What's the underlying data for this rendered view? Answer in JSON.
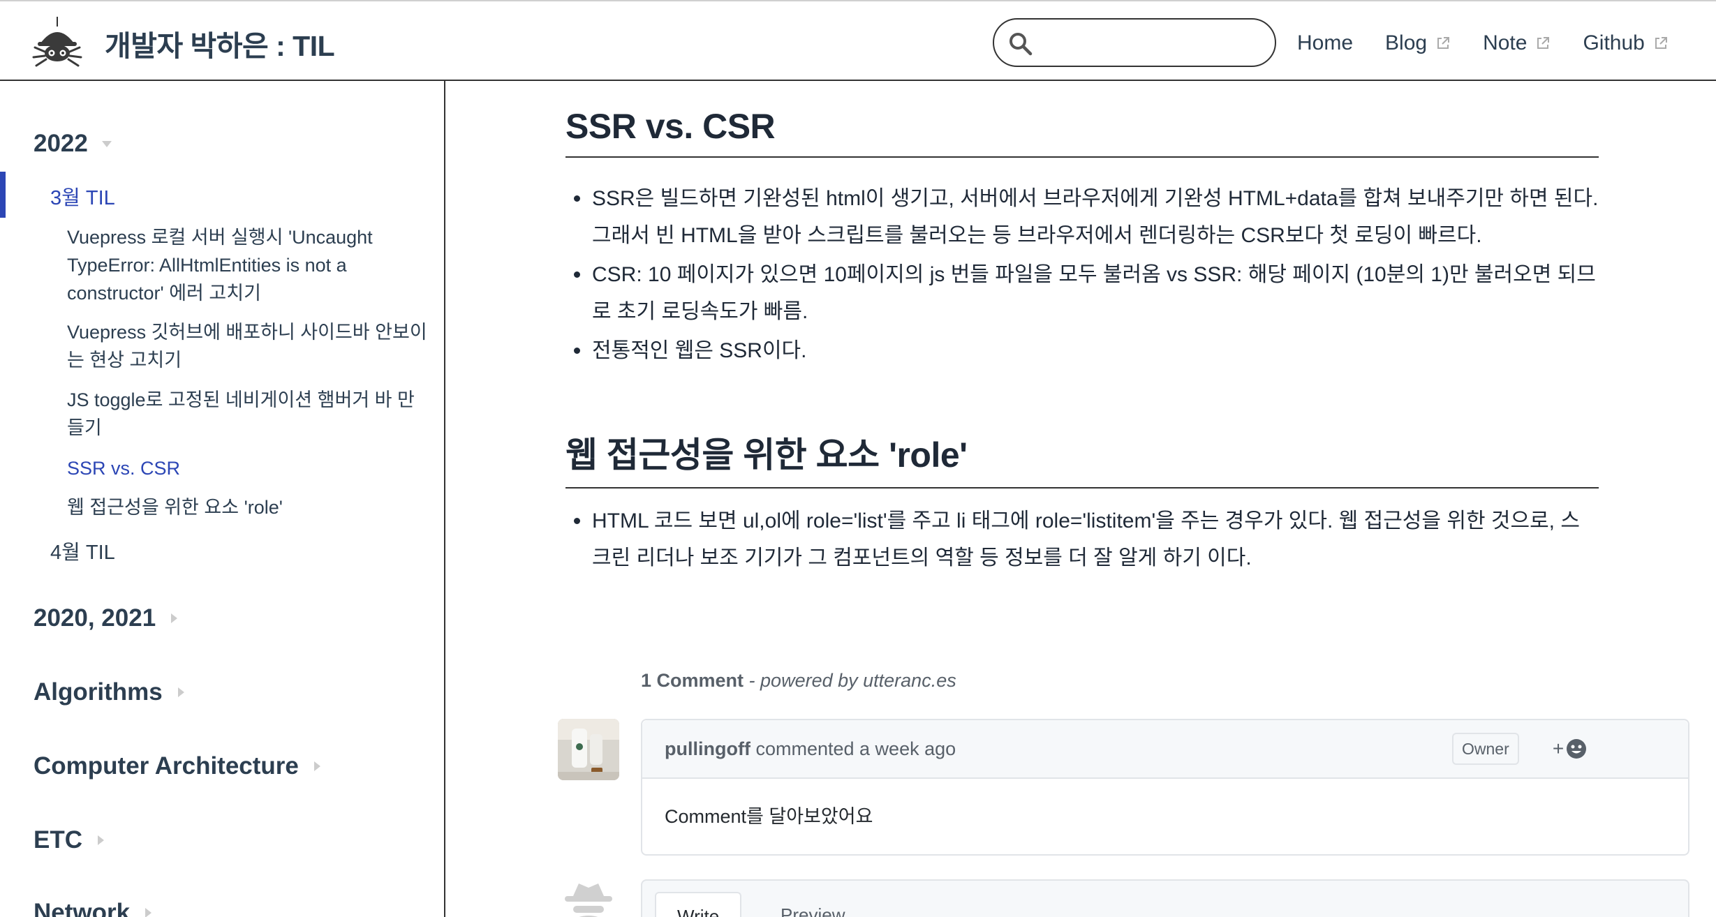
{
  "header": {
    "site_title": "개발자 박하은 : TIL",
    "logo_icon": "spider-logo-icon",
    "search": {
      "placeholder": "",
      "value": ""
    },
    "nav": [
      {
        "label": "Home",
        "external": false
      },
      {
        "label": "Blog",
        "external": true
      },
      {
        "label": "Note",
        "external": true
      },
      {
        "label": "Github",
        "external": true
      }
    ]
  },
  "sidebar": {
    "groups": [
      {
        "label": "2022",
        "expanded": true,
        "subgroups": [
          {
            "label": "3월 TIL",
            "active": true,
            "pages": [
              {
                "label": "Vuepress 로컬 서버 실행시 'Uncaught TypeError: AllHtmlEntities is not a constructor' 에러 고치기"
              },
              {
                "label": "Vuepress 깃허브에 배포하니 사이드바 안보이는 현상 고치기"
              },
              {
                "label": "JS toggle로 고정된 네비게이션 햄버거 바 만들기"
              },
              {
                "label": "SSR vs. CSR",
                "active": true
              },
              {
                "label": "웹 접근성을 위한 요소 'role'"
              }
            ]
          },
          {
            "label": "4월 TIL",
            "active": false
          }
        ]
      },
      {
        "label": "2020, 2021",
        "expanded": false
      },
      {
        "label": "Algorithms",
        "expanded": false
      },
      {
        "label": "Computer Architecture",
        "expanded": false
      },
      {
        "label": "ETC",
        "expanded": false
      },
      {
        "label": "Network",
        "expanded": false
      }
    ]
  },
  "content": {
    "sections": [
      {
        "heading": "SSR vs. CSR",
        "bullets": [
          "SSR은 빌드하면 기완성된 html이 생기고, 서버에서 브라우저에게 기완성 HTML+data를 합쳐 보내주기만 하면 된다. 그래서 빈 HTML을 받아 스크립트를 불러오는 등 브라우저에서 렌더링하는 CSR보다 첫 로딩이 빠르다.",
          "CSR: 10 페이지가 있으면 10페이지의 js 번들 파일을 모두 불러옴 vs SSR: 해당 페이지 (10분의 1)만 불러오면 되므로 초기 로딩속도가 빠름.",
          "전통적인 웹은 SSR이다."
        ]
      },
      {
        "heading": "웹 접근성을 위한 요소 'role'",
        "bullets": [
          "HTML 코드 보면 ul,ol에 role='list'를 주고 li 태그에 role='listitem'을 주는 경우가 있다. 웹 접근성을 위한 것으로, 스크린 리더나 보조 기기가 그 컴포넌트의 역할 등 정보를 더 잘 알게 하기 이다."
        ]
      }
    ]
  },
  "comments": {
    "count_label": "1 Comment",
    "powered_by": "- powered by utteranc.es",
    "items": [
      {
        "author": "pullingoff",
        "action": "commented a week ago",
        "badge": "Owner",
        "body": "Comment를 달아보았어요"
      }
    ],
    "reaction_label": "+",
    "editor_tabs": {
      "write": "Write",
      "preview": "Preview"
    }
  },
  "colors": {
    "text": "#2c3e50",
    "accent": "#2c46b5",
    "border": "#333333",
    "comment_border": "#e1e4e8",
    "muted": "#586069"
  }
}
